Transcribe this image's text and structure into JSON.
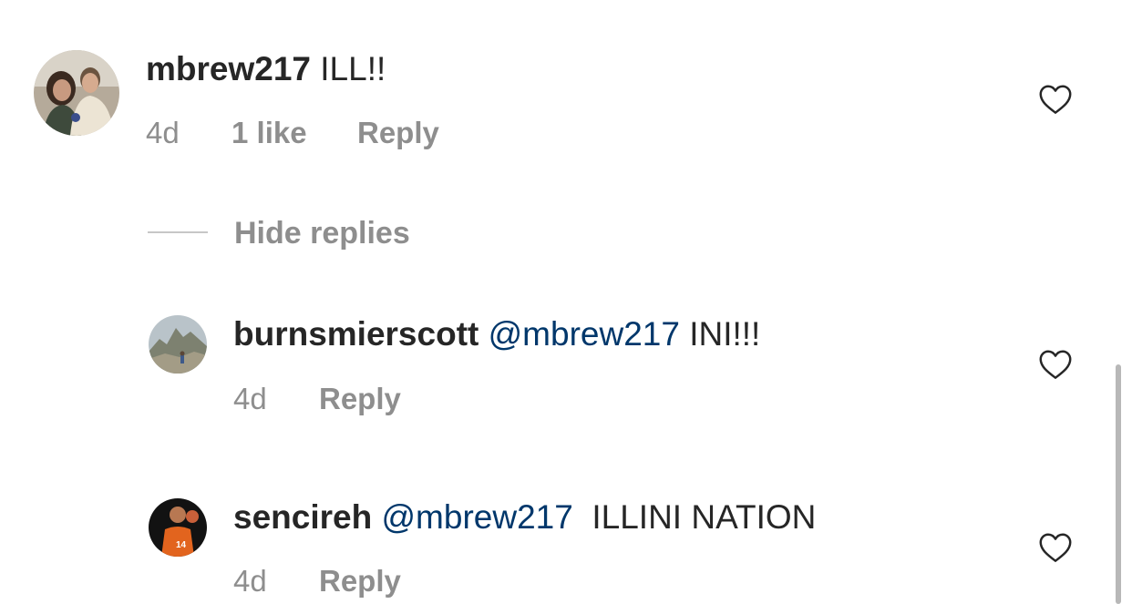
{
  "comments": [
    {
      "username": "mbrew217",
      "text": "ILL!!",
      "time": "4d",
      "likes": "1 like",
      "reply": "Reply",
      "avatar": "couple-photo-avatar"
    }
  ],
  "hide_replies": "Hide replies",
  "replies": [
    {
      "username": "burnsmierscott",
      "mention": "@mbrew217",
      "text": "INI!!!",
      "time": "4d",
      "reply": "Reply",
      "avatar": "mountain-photo-avatar"
    },
    {
      "username": "sencireh",
      "mention": "@mbrew217",
      "text": " ILLINI NATION",
      "time": "4d",
      "reply": "Reply",
      "avatar": "basketball-player-avatar"
    }
  ],
  "colors": {
    "text": "#262626",
    "meta": "#8e8e8e",
    "mention": "#00376b"
  },
  "icons": [
    "heart-outline-icon"
  ]
}
